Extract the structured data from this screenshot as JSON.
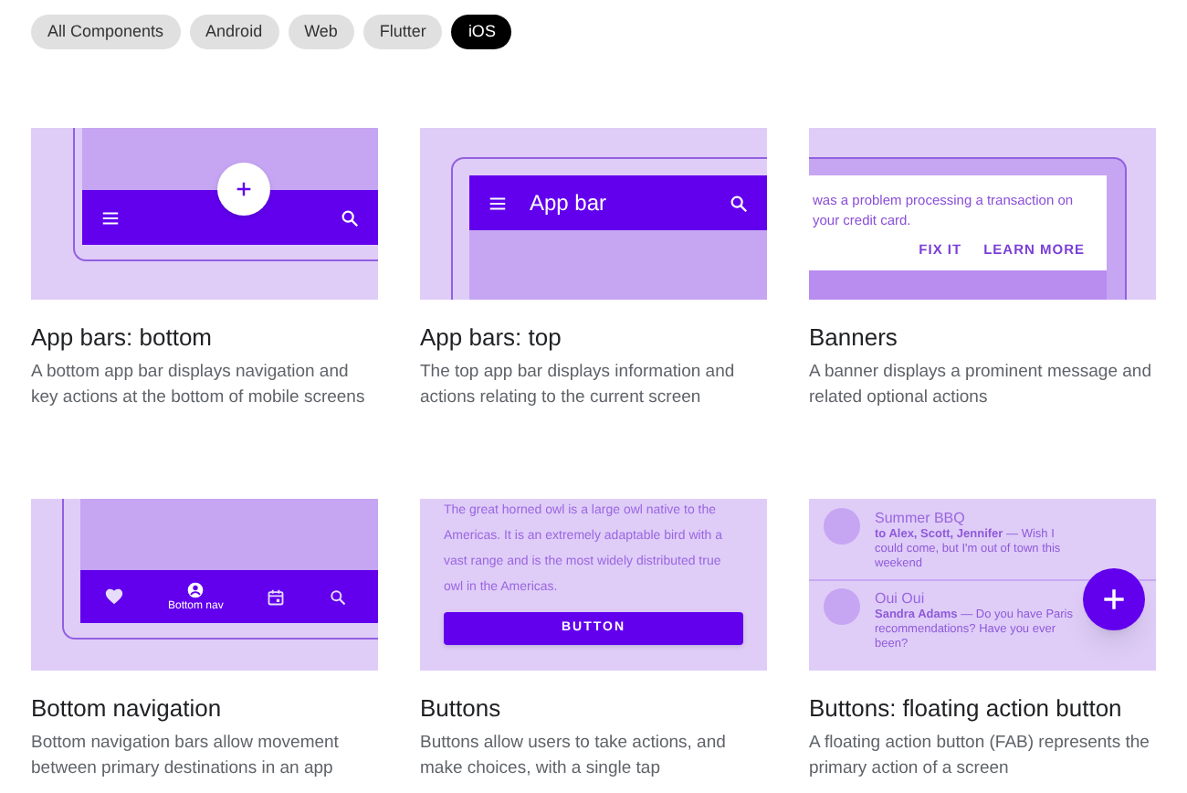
{
  "filters": [
    {
      "label": "All Components",
      "selected": false
    },
    {
      "label": "Android",
      "selected": false
    },
    {
      "label": "Web",
      "selected": false
    },
    {
      "label": "Flutter",
      "selected": false
    },
    {
      "label": "iOS",
      "selected": true
    }
  ],
  "cards": [
    {
      "kind": "bottom_app_bar",
      "title": "App bars: bottom",
      "description": "A bottom app bar displays navigation and key actions at the bottom of mobile screens"
    },
    {
      "kind": "top_app_bar",
      "title": "App bars: top",
      "description": "The top app bar displays information and actions relating to the current screen",
      "bar_title": "App bar"
    },
    {
      "kind": "banner",
      "title": "Banners",
      "description": "A banner displays a prominent message and related optional actions",
      "message": "was a problem processing a transaction on your credit card.",
      "actions": [
        "FIX IT",
        "LEARN MORE"
      ]
    },
    {
      "kind": "bottom_nav",
      "title": "Bottom navigation",
      "description": "Bottom navigation bars allow movement between primary destinations in an app",
      "nav_label": "Bottom nav"
    },
    {
      "kind": "button",
      "title": "Buttons",
      "description": "Buttons allow users to take actions, and make choices, with a single tap",
      "body_text": "The great horned owl is a large owl native to the Americas. It is an extremely adaptable bird with a vast range and is the most widely distributed true owl in the Americas.",
      "button_label": "BUTTON"
    },
    {
      "kind": "fab",
      "title": "Buttons: floating action button",
      "description": "A floating action button (FAB) represents the primary action of a screen",
      "messages": [
        {
          "subject": "Summer BBQ",
          "preview": "**to Alex, Scott, Jennifer** — Wish I could come, but I'm out of town this weekend"
        },
        {
          "subject": "Oui Oui",
          "preview": "**Sandra Adams** — Do you have Paris recommendations? Have you ever been?"
        }
      ]
    }
  ]
}
